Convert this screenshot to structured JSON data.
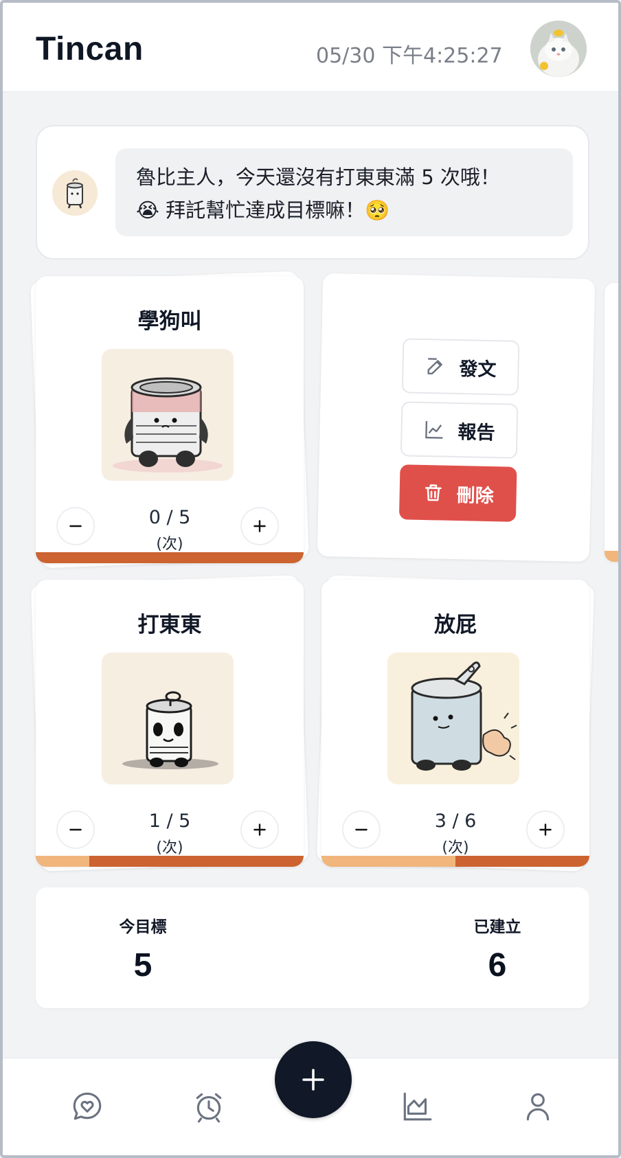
{
  "header": {
    "app_title": "Tincan",
    "clock": "05/30 下午4:25:27",
    "avatar_icon": "cat-avatar"
  },
  "message": {
    "line1": "魯比主人，今天還沒有打東東滿 5 次哦！",
    "line2": "😭 拜託幫忙達成目標嘛！🥺"
  },
  "cards": [
    {
      "title": "學狗叫",
      "count": "0 / 5",
      "unit": "(次)",
      "progress": 0.0,
      "image": "sad-tincan-illustration"
    },
    {
      "title": "打東東",
      "count": "1 / 5",
      "unit": "(次)",
      "progress": 0.2,
      "image": "open-tincan-illustration"
    },
    {
      "title": "放屁",
      "count": "3 / 6",
      "unit": "(次)",
      "progress": 0.5,
      "image": "farting-tincan-illustration"
    }
  ],
  "actions": {
    "post_label": "發文",
    "report_label": "報告",
    "delete_label": "刪除"
  },
  "stats": {
    "goal_label": "今目標",
    "goal_value": "5",
    "created_label": "已建立",
    "created_value": "6"
  },
  "nav": {
    "items": [
      "chat-heart-icon",
      "alarm-clock-icon",
      "chart-icon",
      "user-icon"
    ],
    "fab": "plus-icon"
  },
  "colors": {
    "progress_track": "#cc6330",
    "progress_fill": "#f0b67c",
    "danger": "#e0504b",
    "fab": "#111827"
  }
}
